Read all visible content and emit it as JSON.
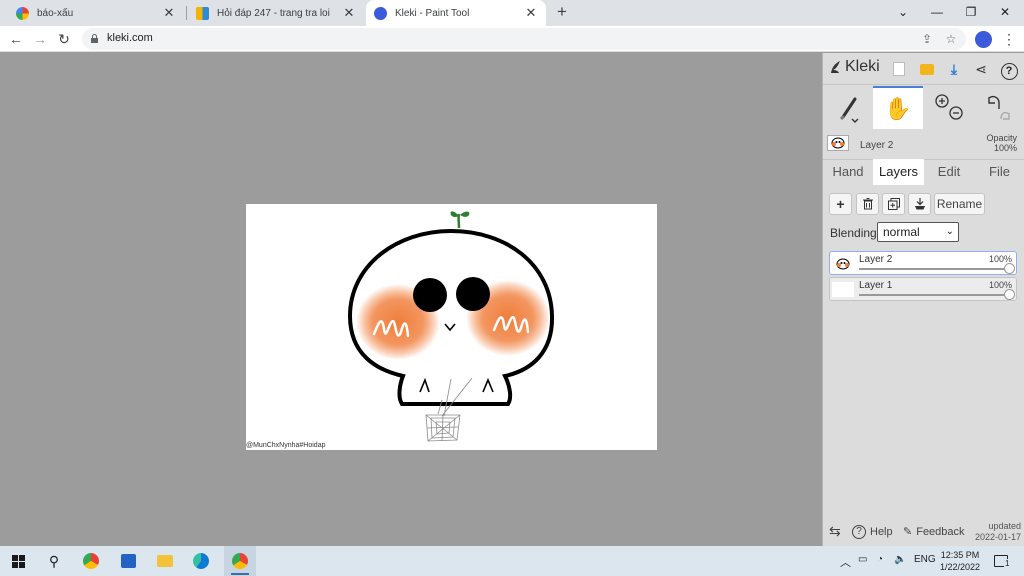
{
  "browser": {
    "tabs": [
      {
        "title": "báo-xấu",
        "active": false
      },
      {
        "title": "Hỏi đáp 247 - trang tra loi",
        "active": false
      },
      {
        "title": "Kleki - Paint Tool",
        "active": true
      }
    ],
    "url": "kleki.com"
  },
  "canvas": {
    "watermark": "@MunChxNynha#Hoidap"
  },
  "kleki": {
    "logo": "Kleki",
    "current_layer": "Layer 2",
    "opacity_label": "Opacity",
    "opacity_value": "100%",
    "tabs": [
      "Hand",
      "Layers",
      "Edit",
      "File"
    ],
    "active_tab": "Layers",
    "rename_label": "Rename",
    "blending_label": "Blending",
    "blending_value": "normal",
    "layers": [
      {
        "name": "Layer 2",
        "opacity": "100%",
        "selected": true
      },
      {
        "name": "Layer 1",
        "opacity": "100%",
        "selected": false
      }
    ],
    "footer": {
      "help": "Help",
      "feedback": "Feedback",
      "updated_label": "updated",
      "updated_date": "2022-01-17"
    }
  },
  "taskbar": {
    "language": "ENG",
    "time": "12:35 PM",
    "date": "1/22/2022",
    "notification_count": "1"
  },
  "colors": {
    "tab_strip": "#dee1e6",
    "workspace": "#9c9c9c",
    "panel": "#dcdcdc",
    "accent": "#4a7fd4",
    "blush": "#f07d3a",
    "taskbar": "#dce6ef"
  }
}
